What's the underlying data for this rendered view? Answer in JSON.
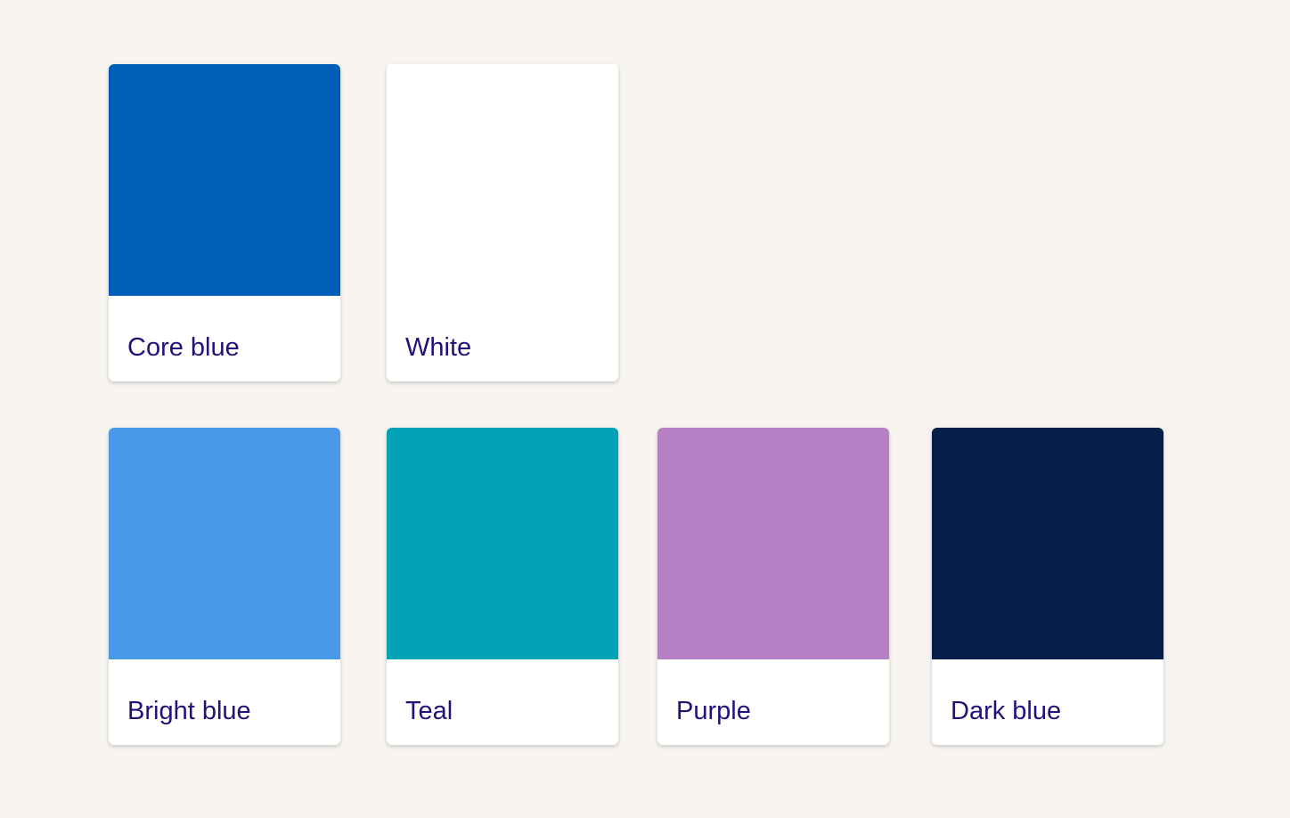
{
  "palette": {
    "rows": [
      {
        "swatches": [
          {
            "name": "Core blue",
            "color": "#005eb8"
          },
          {
            "name": "White",
            "color": "#ffffff"
          }
        ]
      },
      {
        "swatches": [
          {
            "name": "Bright blue",
            "color": "#4a99e8"
          },
          {
            "name": "Teal",
            "color": "#02a3b6"
          },
          {
            "name": "Purple",
            "color": "#b780c4"
          },
          {
            "name": "Dark blue",
            "color": "#061e48"
          }
        ]
      }
    ]
  }
}
